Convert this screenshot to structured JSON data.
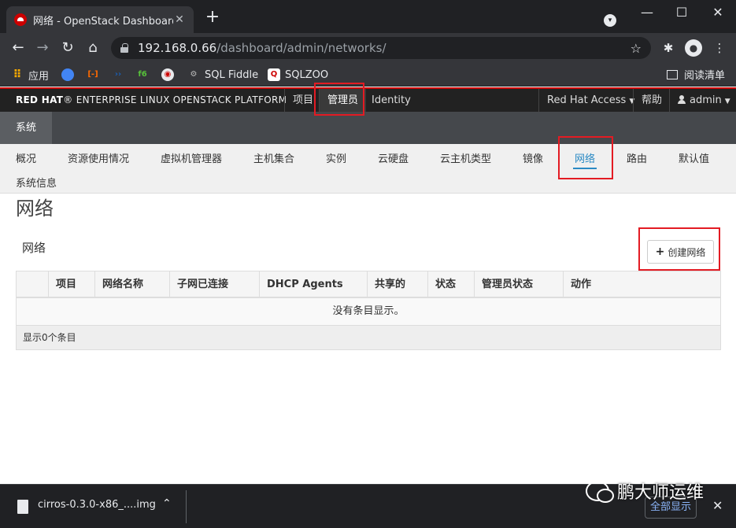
{
  "browser": {
    "tab_title": "网络 - OpenStack Dashboard",
    "tab_close": "✕",
    "newtab": "+",
    "url_host": "192.168.0.66",
    "url_path": "/dashboard/admin/networks/",
    "bookmarks": [
      {
        "label": "应用"
      },
      {
        "label": ""
      },
      {
        "label": ""
      },
      {
        "label": ""
      },
      {
        "label": ""
      },
      {
        "label": ""
      },
      {
        "label": "SQL Fiddle"
      },
      {
        "label": "SQLZOO"
      }
    ],
    "reading_list": "阅读清单"
  },
  "header": {
    "brand_bold": "RED HAT",
    "brand_rest": "ENTERPRISE LINUX OPENSTACK PLATFORM",
    "nav": [
      {
        "label": "项目"
      },
      {
        "label": "管理员"
      },
      {
        "label": "Identity"
      }
    ],
    "right": {
      "rh_access": "Red Hat Access",
      "help": "帮助",
      "user": "admin"
    }
  },
  "subbar": {
    "label": "系统"
  },
  "secnav": {
    "items": [
      {
        "label": "概况"
      },
      {
        "label": "资源使用情况"
      },
      {
        "label": "虚拟机管理器"
      },
      {
        "label": "主机集合"
      },
      {
        "label": "实例"
      },
      {
        "label": "云硬盘"
      },
      {
        "label": "云主机类型"
      },
      {
        "label": "镜像"
      },
      {
        "label": "网络"
      },
      {
        "label": "路由"
      },
      {
        "label": "默认值"
      },
      {
        "label": "系统信息"
      }
    ]
  },
  "main": {
    "page_title": "网络",
    "section_title": "网络",
    "create_button": "创建网络",
    "table": {
      "columns": [
        "项目",
        "网络名称",
        "子网已连接",
        "DHCP Agents",
        "共享的",
        "状态",
        "管理员状态",
        "动作"
      ],
      "empty_text": "没有条目显示。",
      "footer": "显示0个条目"
    }
  },
  "downloads": {
    "file_name": "cirros-0.3.0-x86_....img",
    "show_all": "全部显示",
    "watermark": "鹏大师运维"
  },
  "colors": {
    "accent": "#2b8ac4",
    "brand_red": "#cc0000",
    "annotation_red": "#e31b23"
  }
}
